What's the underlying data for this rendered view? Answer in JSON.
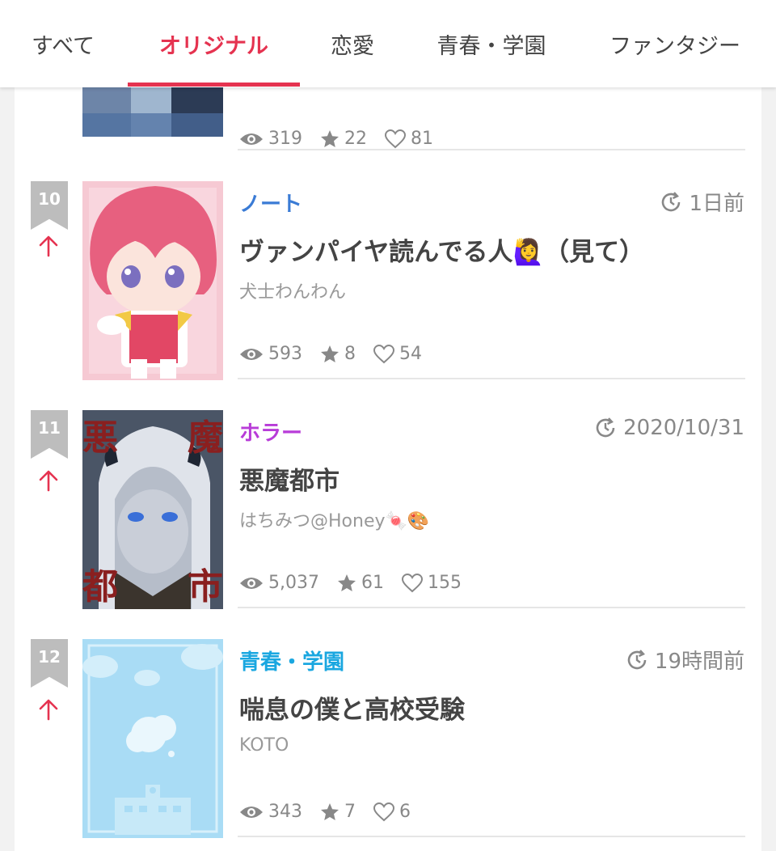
{
  "tabs": [
    {
      "label": "すべて"
    },
    {
      "label": "オリジナル",
      "active": true
    },
    {
      "label": "恋愛"
    },
    {
      "label": "青春・学園"
    },
    {
      "label": "ファンタジー"
    }
  ],
  "colors": {
    "accent": "#e53350",
    "genre_note": "#3a7bd5",
    "genre_horror": "#b83cd8",
    "genre_youth": "#1aa7e0"
  },
  "partial_item": {
    "views": "319",
    "stars": "22",
    "likes": "81"
  },
  "items": [
    {
      "rank": "10",
      "genre": "ノート",
      "time": "1日前",
      "title": "ヴァンパイヤ読んでる人🙋‍♀️（見て）",
      "author": "犬士わんわん",
      "views": "593",
      "stars": "8",
      "likes": "54",
      "thumb_text": []
    },
    {
      "rank": "11",
      "genre": "ホラー",
      "time": "2020/10/31",
      "title": "悪魔都市",
      "author": "はちみつ@Honey🍬🎨",
      "views": "5,037",
      "stars": "61",
      "likes": "155",
      "thumb_text": [
        "悪",
        "魔",
        "都",
        "市"
      ]
    },
    {
      "rank": "12",
      "genre": "青春・学園",
      "time": "19時間前",
      "title": "喘息の僕と高校受験",
      "author": "KOTO",
      "views": "343",
      "stars": "7",
      "likes": "6",
      "thumb_text": []
    }
  ]
}
